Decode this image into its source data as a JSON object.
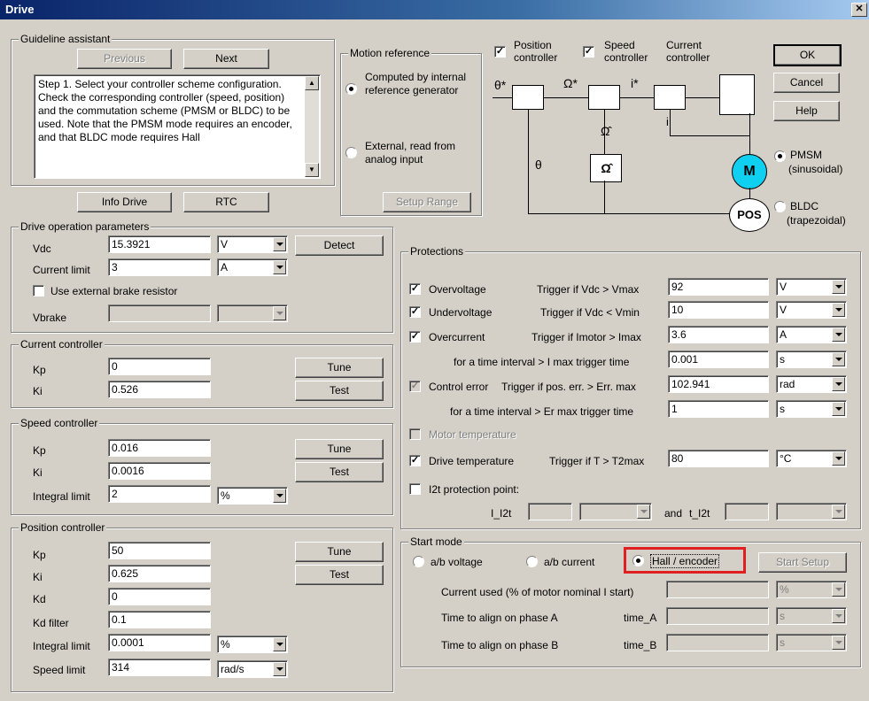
{
  "window": {
    "title": "Drive"
  },
  "guideline": {
    "legend": "Guideline assistant",
    "previous_label": "Previous",
    "next_label": "Next",
    "step_text": "Step 1.    Select your controller scheme configuration. Check the corresponding controller (speed, position) and the commutation scheme (PMSM or BLDC) to be used. Note that the PMSM mode requires an encoder, and that BLDC mode requires Hall"
  },
  "motion_reference": {
    "legend": "Motion reference",
    "option_internal": "Computed by internal reference generator",
    "option_external": "External, read from analog input",
    "selected": "internal",
    "setup_range_label": "Setup Range"
  },
  "diagram": {
    "position_controller_label": "Position controller",
    "speed_controller_label": "Speed controller",
    "current_controller_label": "Current controller",
    "position_checked": true,
    "speed_checked": true,
    "theta_star": "θ*",
    "omega_star": "Ω*",
    "i_star": "i*",
    "omega_hat": "Ω̂",
    "omega_hat_box": "Ω̂",
    "i_fb": "i",
    "theta": "θ",
    "motor_label": "M",
    "pos_label": "POS"
  },
  "commutation": {
    "pmsm_label": "PMSM",
    "pmsm_sub": "(sinusoidal)",
    "bldc_label": "BLDC",
    "bldc_sub": "(trapezoidal)",
    "selected": "PMSM"
  },
  "dialog_buttons": {
    "ok": "OK",
    "cancel": "Cancel",
    "help": "Help"
  },
  "actions": {
    "info_drive": "Info Drive",
    "rtc": "RTC"
  },
  "drive_params": {
    "legend": "Drive operation parameters",
    "vdc_label": "Vdc",
    "vdc_value": "15.3921",
    "vdc_unit": "V",
    "detect_label": "Detect",
    "current_limit_label": "Current limit",
    "current_limit_value": "3",
    "current_limit_unit": "A",
    "brake_label": "Use external brake resistor",
    "brake_checked": false,
    "vbrake_label": "Vbrake",
    "vbrake_value": "",
    "vbrake_unit": ""
  },
  "current_controller": {
    "legend": "Current controller",
    "kp_label": "Kp",
    "kp_value": "0",
    "ki_label": "Ki",
    "ki_value": "0.526",
    "tune_label": "Tune",
    "test_label": "Test"
  },
  "speed_controller": {
    "legend": "Speed controller",
    "kp_label": "Kp",
    "kp_value": "0.016",
    "ki_label": "Ki",
    "ki_value": "0.0016",
    "integral_limit_label": "Integral limit",
    "integral_limit_value": "2",
    "integral_limit_unit": "%",
    "tune_label": "Tune",
    "test_label": "Test"
  },
  "position_controller": {
    "legend": "Position controller",
    "kp_label": "Kp",
    "kp_value": "50",
    "ki_label": "Ki",
    "ki_value": "0.625",
    "kd_label": "Kd",
    "kd_value": "0",
    "kd_filter_label": "Kd filter",
    "kd_filter_value": "0.1",
    "integral_limit_label": "Integral limit",
    "integral_limit_value": "0.0001",
    "integral_limit_unit": "%",
    "speed_limit_label": "Speed limit",
    "speed_limit_value": "314",
    "speed_limit_unit": "rad/s",
    "tune_label": "Tune",
    "test_label": "Test"
  },
  "protections": {
    "legend": "Protections",
    "overvoltage_label": "Overvoltage",
    "overvoltage_trigger": "Trigger if Vdc > Vmax",
    "overvoltage_value": "92",
    "overvoltage_unit": "V",
    "undervoltage_label": "Undervoltage",
    "undervoltage_trigger": "Trigger if Vdc < Vmin",
    "undervoltage_value": "10",
    "undervoltage_unit": "V",
    "overcurrent_label": "Overcurrent",
    "overcurrent_trigger": "Trigger if Imotor > Imax",
    "overcurrent_value": "3.6",
    "overcurrent_unit": "A",
    "imax_time_label": "for a time interval > I max trigger time",
    "imax_time_value": "0.001",
    "imax_time_unit": "s",
    "control_error_label": "Control error",
    "control_error_trigger": "Trigger if pos. err. > Err. max",
    "control_error_value": "102.941",
    "control_error_unit": "rad",
    "err_time_label": "for a time interval > Er max trigger time",
    "err_time_value": "1",
    "err_time_unit": "s",
    "motor_temp_label": "Motor temperature",
    "drive_temp_label": "Drive temperature",
    "drive_temp_trigger": "Trigger if T > T2max",
    "drive_temp_value": "80",
    "drive_temp_unit": "°C",
    "i2t_label": "I2t  protection point:",
    "i_i2t_label": "I_I2t",
    "and_label": "and",
    "t_i2t_label": "t_I2t"
  },
  "start_mode": {
    "legend": "Start mode",
    "ab_voltage": "a/b voltage",
    "ab_current": "a/b current",
    "hall_encoder": "Hall / encoder",
    "selected": "Hall / encoder",
    "highlight_color": "#e02020",
    "start_setup_label": "Start Setup",
    "current_used_label": "Current used (% of motor nominal I start)",
    "current_used_unit": "%",
    "align_a_label": "Time to align on phase A",
    "time_a_label": "time_A",
    "time_a_unit": "s",
    "align_b_label": "Time to align on phase B",
    "time_b_label": "time_B",
    "time_b_unit": "s"
  }
}
